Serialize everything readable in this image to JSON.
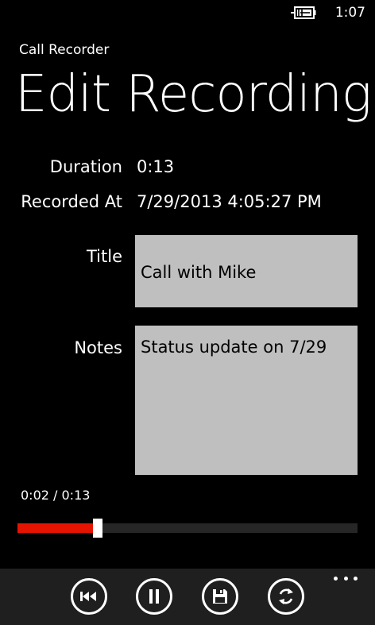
{
  "status_bar": {
    "battery_icon": "battery-charging-icon",
    "time": "1:07"
  },
  "app": {
    "name": "Call Recorder",
    "page_title": "Edit Recording"
  },
  "details": {
    "duration_label": "Duration",
    "duration_value": "0:13",
    "recorded_at_label": "Recorded At",
    "recorded_at_value": "7/29/2013 4:05:27 PM"
  },
  "form": {
    "title_label": "Title",
    "title_value": "Call with Mike",
    "notes_label": "Notes",
    "notes_value": "Status update on 7/29"
  },
  "playback": {
    "time_readout": "0:02 / 0:13",
    "progress_fraction": 0.237,
    "fill_color": "#e51400",
    "track_color": "#262626"
  },
  "app_bar": {
    "buttons": [
      {
        "icon": "skip-back-icon"
      },
      {
        "icon": "pause-icon"
      },
      {
        "icon": "save-icon"
      },
      {
        "icon": "sync-icon"
      }
    ],
    "overflow_icon": "more-icon"
  }
}
